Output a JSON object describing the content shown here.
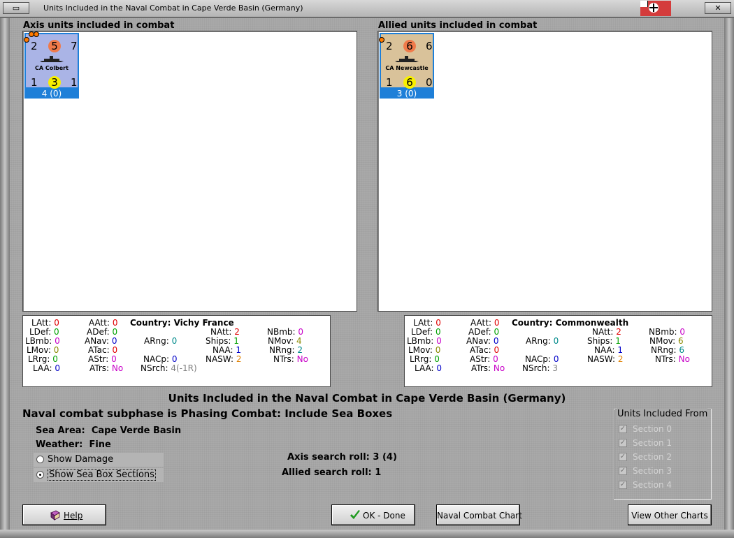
{
  "window": {
    "title": "Units Included in the Naval Combat in Cape Verde Basin (Germany)",
    "min_label": "▭",
    "close_label": "✕"
  },
  "axis": {
    "header": "Axis units included in combat",
    "counter": {
      "top_left": "2",
      "top_mid": "5",
      "top_right": "7",
      "name": "CA Colbert",
      "bot_left": "1",
      "bot_mid": "3",
      "bot_right": "1",
      "foot": "4 (0)",
      "face_color": "#aab4e6"
    },
    "stats": {
      "country_label": "Country:",
      "country": "Vichy France",
      "LAtt": "0",
      "LDef": "0",
      "LBmb": "0",
      "LMov": "0",
      "LRrg": "0",
      "LAA": "0",
      "AAtt": "0",
      "ADef": "0",
      "ANav": "0",
      "ATac": "0",
      "AStr": "0",
      "ATrs": "No",
      "ARng": "0",
      "NACp": "0",
      "NSrch": "4(-1R)",
      "NAtt": "2",
      "Ships": "1",
      "NAA": "1",
      "NASW": "2",
      "NBmb": "0",
      "NMov": "4",
      "NRng": "2",
      "NTrs": "No"
    }
  },
  "allied": {
    "header": "Allied units included in combat",
    "counter": {
      "top_left": "2",
      "top_mid": "6",
      "top_right": "6",
      "name": "CA Newcastle",
      "bot_left": "1",
      "bot_mid": "6",
      "bot_right": "0",
      "foot": "3 (0)",
      "face_color": "#d9c29a"
    },
    "stats": {
      "country_label": "Country:",
      "country": "Commonwealth",
      "LAtt": "0",
      "LDef": "0",
      "LBmb": "0",
      "LMov": "0",
      "LRrg": "0",
      "LAA": "0",
      "AAtt": "0",
      "ADef": "0",
      "ANav": "0",
      "ATac": "0",
      "AStr": "0",
      "ATrs": "No",
      "ARng": "0",
      "NACp": "0",
      "NSrch": "3",
      "NAtt": "2",
      "Ships": "1",
      "NAA": "1",
      "NASW": "2",
      "NBmb": "0",
      "NMov": "6",
      "NRng": "6",
      "NTrs": "No"
    }
  },
  "labels": {
    "LAtt": "LAtt:",
    "LDef": "LDef:",
    "LBmb": "LBmb:",
    "LMov": "LMov:",
    "LRrg": "LRrg:",
    "LAA": "LAA:",
    "AAtt": "AAtt:",
    "ADef": "ADef:",
    "ANav": "ANav:",
    "ATac": "ATac:",
    "AStr": "AStr:",
    "ATrs": "ATrs:",
    "ARng": "ARng:",
    "NACp": "NACp:",
    "NSrch": "NSrch:",
    "NAtt": "NAtt:",
    "Ships": "Ships:",
    "NAA": "NAA:",
    "NASW": "NASW:",
    "NBmb": "NBmb:",
    "NMov": "NMov:",
    "NRng": "NRng:",
    "NTrs": "NTrs:"
  },
  "main": {
    "title": "Units Included in the Naval Combat in Cape Verde Basin (Germany)",
    "subphase": "Naval combat subphase is Phasing Combat: Include Sea Boxes",
    "sea_area_label": "Sea Area:",
    "sea_area": "Cape Verde Basin",
    "weather_label": "Weather:",
    "weather": "Fine",
    "show_damage": "Show Damage",
    "show_sections": "Show Sea Box Sections",
    "axis_roll_label": "Axis search roll:",
    "axis_roll": "3 (4)",
    "allied_roll_label": "Allied search roll:",
    "allied_roll": "1"
  },
  "sections": {
    "title": "Units Included From",
    "items": [
      "Section 0",
      "Section 1",
      "Section 2",
      "Section 3",
      "Section 4"
    ]
  },
  "buttons": {
    "help": "Help",
    "ok": "OK - Done",
    "chart": "Naval Combat Chart",
    "other": "View Other Charts"
  }
}
